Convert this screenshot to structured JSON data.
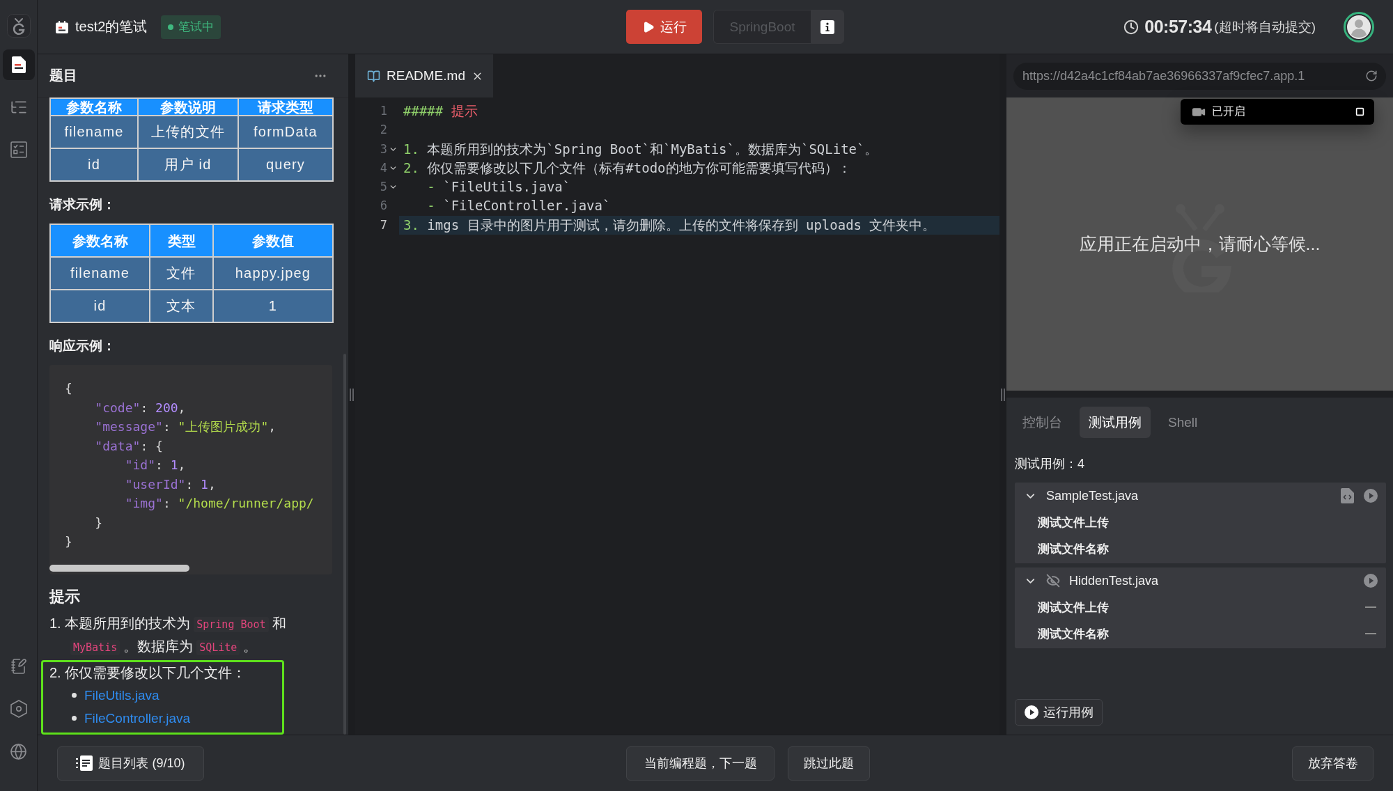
{
  "rail": {
    "items": [
      {
        "selected": true
      },
      {
        "selected": false
      },
      {
        "selected": false
      }
    ]
  },
  "header": {
    "title": "test2的笔试",
    "status": "笔试中",
    "run_button": "运行",
    "runtime_select": {
      "value": "SpringBoot",
      "disabled": true
    },
    "timer": "00:57:34",
    "timer_note": "(超时将自动提交)"
  },
  "problem": {
    "title": "题目",
    "params_table": {
      "columns": [
        "参数名称",
        "参数说明",
        "请求类型"
      ],
      "rows": [
        [
          "filename",
          "上传的文件",
          "formData"
        ],
        [
          "id",
          "用户 id",
          "query"
        ]
      ]
    },
    "request_heading": "请求示例：",
    "request_table": {
      "columns": [
        "参数名称",
        "类型",
        "参数值"
      ],
      "rows": [
        [
          "filename",
          "文件",
          "happy.jpeg"
        ],
        [
          "id",
          "文本",
          "1"
        ]
      ]
    },
    "response_heading": "响应示例：",
    "response_code": [
      [
        {
          "kind": "punct",
          "text": "{"
        }
      ],
      [
        {
          "kind": "key",
          "text": "    \"code\""
        },
        {
          "kind": "punct",
          "text": ": "
        },
        {
          "kind": "number",
          "text": "200"
        },
        {
          "kind": "punct",
          "text": ","
        }
      ],
      [
        {
          "kind": "key",
          "text": "    \"message\""
        },
        {
          "kind": "punct",
          "text": ": "
        },
        {
          "kind": "string",
          "text": "\"上传图片成功\""
        },
        {
          "kind": "punct",
          "text": ","
        }
      ],
      [
        {
          "kind": "key",
          "text": "    \"data\""
        },
        {
          "kind": "punct",
          "text": ": {"
        }
      ],
      [
        {
          "kind": "key",
          "text": "        \"id\""
        },
        {
          "kind": "punct",
          "text": ": "
        },
        {
          "kind": "number",
          "text": "1"
        },
        {
          "kind": "punct",
          "text": ","
        }
      ],
      [
        {
          "kind": "key",
          "text": "        \"userId\""
        },
        {
          "kind": "punct",
          "text": ": "
        },
        {
          "kind": "number",
          "text": "1"
        },
        {
          "kind": "punct",
          "text": ","
        }
      ],
      [
        {
          "kind": "key",
          "text": "        \"img\""
        },
        {
          "kind": "punct",
          "text": ": "
        },
        {
          "kind": "string",
          "text": "\"/home/runner/app/"
        }
      ],
      [
        {
          "kind": "punct",
          "text": "    }"
        }
      ],
      [
        {
          "kind": "punct",
          "text": "}"
        }
      ]
    ],
    "hint_heading": "提示",
    "hints": [
      {
        "number": "1.",
        "highlighted": false,
        "parts": [
          {
            "kind": "text",
            "text": "本题所用到的技术为"
          },
          {
            "kind": "code",
            "text": "Spring Boot"
          },
          {
            "kind": "text",
            "text": "和"
          },
          {
            "kind": "code",
            "text": "MyBatis"
          },
          {
            "kind": "text",
            "text": "。数据库为"
          },
          {
            "kind": "code",
            "text": "SQLite"
          },
          {
            "kind": "text",
            "text": "。"
          }
        ]
      },
      {
        "number": "2.",
        "highlighted": true,
        "parts": [
          {
            "kind": "text",
            "text": "你仅需要修改以下几个文件："
          }
        ],
        "children": [
          {
            "text": "FileUtils.java"
          },
          {
            "text": "FileController.java"
          }
        ]
      }
    ]
  },
  "editor": {
    "tabs": [
      {
        "label": "README.md",
        "selected": true
      }
    ],
    "lines": [
      {
        "number": "1",
        "foldable": false,
        "active": false,
        "tokens": [
          {
            "kind": "heading_mark",
            "text": "#####"
          },
          {
            "kind": "heading",
            "text": " 提示"
          }
        ]
      },
      {
        "number": "2",
        "foldable": false,
        "active": false
      },
      {
        "number": "3",
        "foldable": true,
        "active": false,
        "tokens": [
          {
            "kind": "list_mark",
            "text": "1."
          },
          {
            "kind": "text",
            "text": " 本题所用到的技术为`Spring Boot`和`MyBatis`。数据库为`SQLite`。"
          }
        ]
      },
      {
        "number": "4",
        "foldable": true,
        "active": false,
        "tokens": [
          {
            "kind": "list_mark",
            "text": "2."
          },
          {
            "kind": "text",
            "text": " 你仅需要修改以下几个文件（标有#todo的地方你可能需要填写代码）："
          }
        ]
      },
      {
        "number": "5",
        "foldable": true,
        "active": false,
        "tokens": [
          {
            "kind": "list_mark",
            "text": "   -"
          },
          {
            "kind": "text",
            "text": " `FileUtils.java`"
          }
        ]
      },
      {
        "number": "6",
        "foldable": false,
        "active": false,
        "tokens": [
          {
            "kind": "list_mark",
            "text": "   -"
          },
          {
            "kind": "text",
            "text": " `FileController.java`"
          }
        ]
      },
      {
        "number": "7",
        "foldable": false,
        "active": true,
        "tokens": [
          {
            "kind": "list_mark",
            "text": "3."
          },
          {
            "kind": "text",
            "text": " imgs 目录中的图片用于测试，请勿删除。上传的文件将保存到 uploads 文件夹中。"
          }
        ]
      }
    ]
  },
  "preview": {
    "url": "https://d42a4c1cf84ab7ae36966337af9cfec7.app.1",
    "recording": "已开启",
    "message": "应用正在启动中，请耐心等候..."
  },
  "console": {
    "tabs": [
      {
        "label": "控制台",
        "selected": false
      },
      {
        "label": "测试用例",
        "selected": true
      },
      {
        "label": "Shell",
        "selected": false
      }
    ],
    "count": "测试用例：4",
    "groups": [
      {
        "name": "SampleTest.java",
        "expanded": true,
        "hidden": false,
        "tests": [
          {
            "name": "测试文件上传",
            "not_run": false
          },
          {
            "name": "测试文件名称",
            "not_run": false
          }
        ]
      },
      {
        "name": "HiddenTest.java",
        "expanded": true,
        "hidden": true,
        "tests": [
          {
            "name": "测试文件上传",
            "not_run": true
          },
          {
            "name": "测试文件名称",
            "not_run": true
          }
        ]
      }
    ],
    "run_button": "运行用例"
  },
  "footer": {
    "problem_list": "题目列表 (9/10)",
    "next": "当前编程题，下一题",
    "skip": "跳过此题",
    "abandon": "放弃答卷"
  }
}
